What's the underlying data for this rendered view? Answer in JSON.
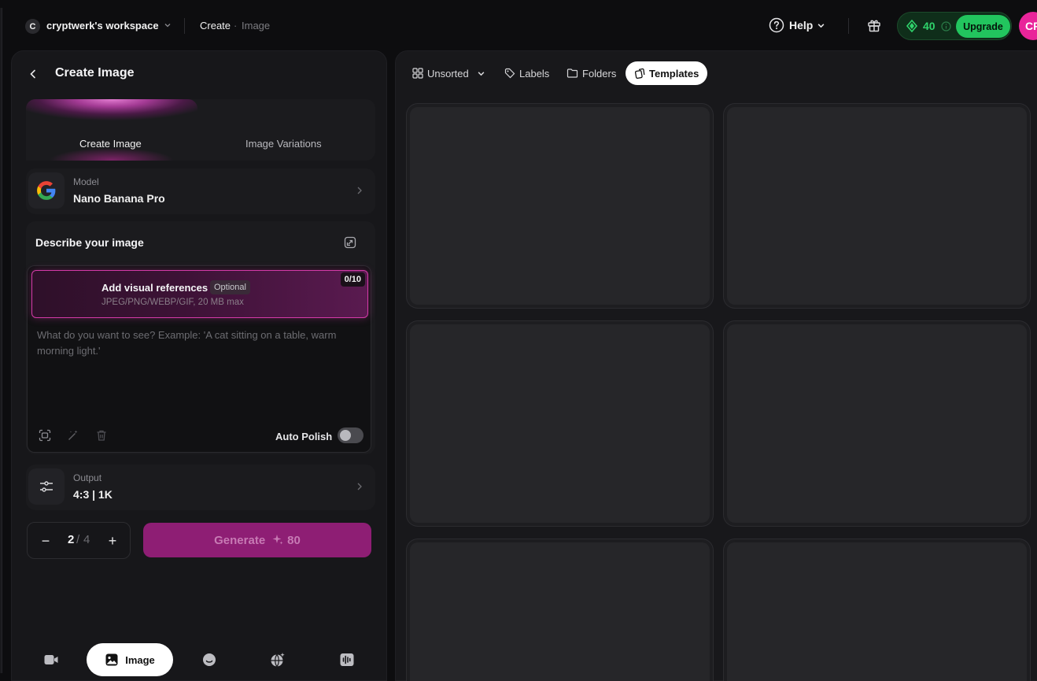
{
  "workspace": {
    "avatar_letter": "C",
    "name": "cryptwerk's workspace"
  },
  "breadcrumb": {
    "section": "Create",
    "separator": "·",
    "page": "Image"
  },
  "header": {
    "help_label": "Help",
    "credits": "40",
    "upgrade_label": "Upgrade",
    "user_initials": "CR"
  },
  "panel": {
    "title": "Create Image",
    "tabs": [
      {
        "label": "Create Image",
        "active": true
      },
      {
        "label": "Image Variations",
        "active": false
      }
    ],
    "model": {
      "label": "Model",
      "value": "Nano Banana Pro"
    },
    "describe": {
      "title": "Describe your image",
      "references": {
        "title": "Add visual references",
        "optional_badge": "Optional",
        "formats": "JPEG/PNG/WEBP/GIF, 20 MB max",
        "count": "0/10"
      },
      "prompt_placeholder": "What do you want to see? Example: 'A cat sitting on a table, warm morning light.'",
      "prompt_value": "",
      "auto_polish_label": "Auto Polish",
      "auto_polish_on": false
    },
    "output": {
      "label": "Output",
      "value": "4:3 | 1K"
    },
    "quantity": {
      "minus": "−",
      "value": "2",
      "separator": "/",
      "max": "4",
      "plus": "+"
    },
    "generate": {
      "label": "Generate",
      "icon": "sparkles-icon",
      "cost": "80"
    }
  },
  "bottom_nav": [
    {
      "name": "video",
      "icon": "video-icon",
      "label": ""
    },
    {
      "name": "image",
      "icon": "image-icon",
      "label": "Image",
      "active": true
    },
    {
      "name": "avatar",
      "icon": "face-icon",
      "label": ""
    },
    {
      "name": "world",
      "icon": "globe-sparkle-icon",
      "label": ""
    },
    {
      "name": "audio",
      "icon": "audio-wave-icon",
      "label": ""
    }
  ],
  "gallery": {
    "filters": [
      {
        "label": "Unsorted",
        "icon": "grid-icon",
        "dropdown": true
      },
      {
        "label": "Labels",
        "icon": "tag-icon"
      },
      {
        "label": "Folders",
        "icon": "folder-icon"
      },
      {
        "label": "Templates",
        "icon": "template-icon",
        "active": true
      }
    ],
    "placeholder_tiles": 6
  },
  "colors": {
    "accent_pink": "#d43aa8",
    "generate_bg": "#8e1e74",
    "credits_green": "#22c55e",
    "background": "#0d0d0f"
  }
}
